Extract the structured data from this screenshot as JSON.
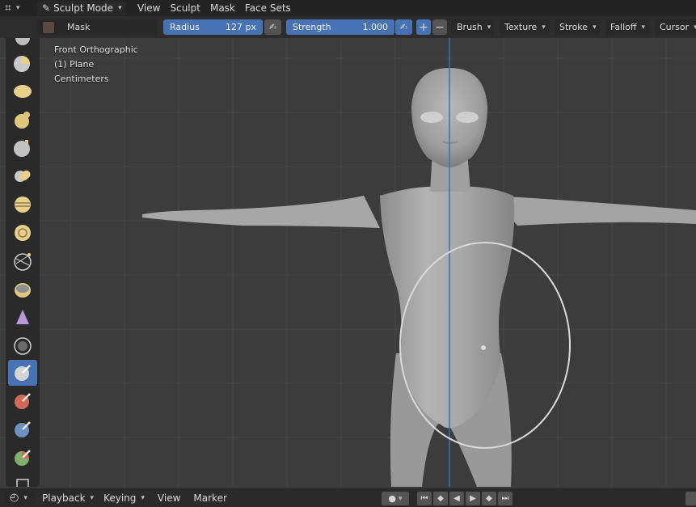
{
  "header": {
    "editor_type_icon": "view3d-grid-icon",
    "mode": "Sculpt Mode",
    "menus": [
      "View",
      "Sculpt",
      "Mask",
      "Face Sets"
    ]
  },
  "toolbar": {
    "tool_name": "Mask",
    "radius_label": "Radius",
    "radius_value": "127 px",
    "strength_label": "Strength",
    "strength_value": "1.000",
    "plus": "+",
    "minus": "−",
    "brush": "Brush",
    "texture": "Texture",
    "stroke": "Stroke",
    "falloff": "Falloff",
    "cursor": "Cursor"
  },
  "viewport": {
    "view_name": "Front Orthographic",
    "object": "(1) Plane",
    "units": "Centimeters"
  },
  "timeline": {
    "playback": "Playback",
    "keying": "Keying",
    "view": "View",
    "marker": "Marker"
  },
  "colors": {
    "accent": "#4772b3",
    "header_bg": "#232323",
    "viewport_bg": "#3c3c3c",
    "axis_line": "#3d6fb5"
  },
  "tools": [
    "draw-brush-icon",
    "clay-brush-icon",
    "clay-strips-icon",
    "layer-brush-icon",
    "inflate-brush-icon",
    "blob-brush-icon",
    "crease-brush-icon",
    "smooth-brush-icon",
    "flatten-brush-icon",
    "fill-brush-icon",
    "scrape-brush-icon",
    "multiplane-scrape-icon",
    "pinch-brush-icon",
    "grab-brush-icon",
    "snake-hook-icon",
    "mask-brush-icon",
    "draw-face-sets-icon",
    "box-mask-icon",
    "lasso-mask-icon"
  ]
}
